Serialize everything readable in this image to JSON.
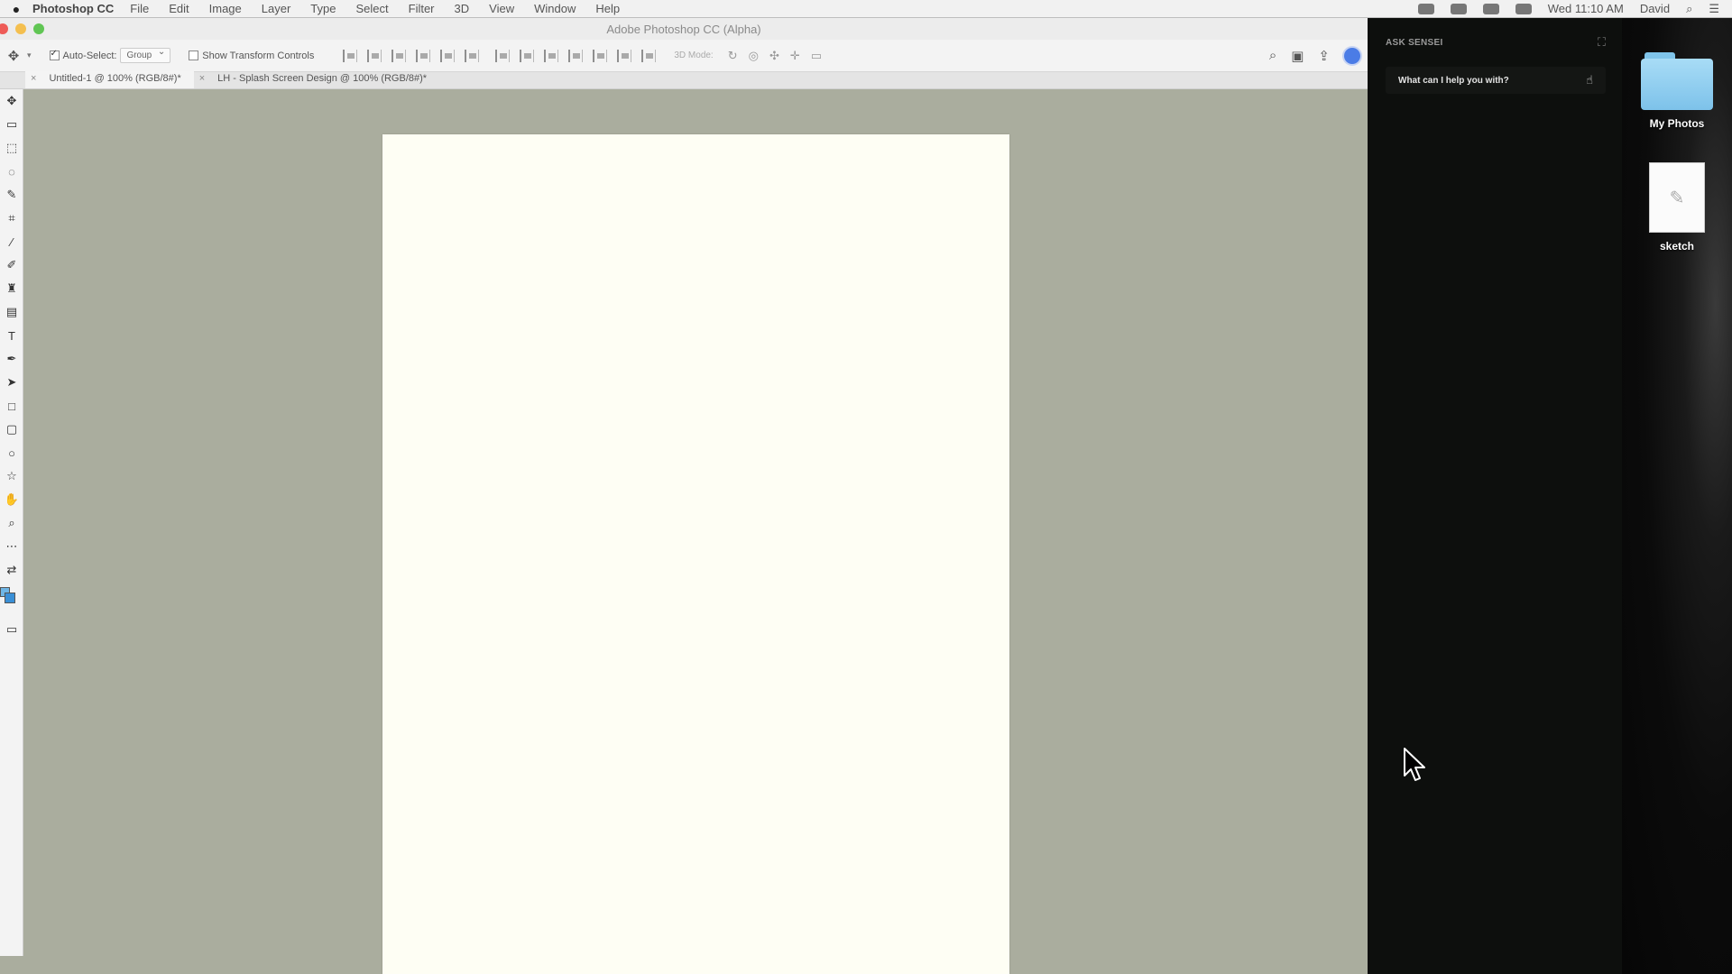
{
  "menubar": {
    "app_name": "Photoshop CC",
    "menus": [
      "File",
      "Edit",
      "Image",
      "Layer",
      "Type",
      "Select",
      "Filter",
      "3D",
      "View",
      "Window",
      "Help"
    ],
    "clock": "Wed 11:10 AM",
    "user": "David"
  },
  "window": {
    "title": "Adobe Photoshop CC (Alpha)"
  },
  "options": {
    "auto_select_label": "Auto-Select:",
    "auto_select_value": "Group",
    "show_transform_label": "Show Transform Controls",
    "mode_3d_label": "3D Mode:"
  },
  "tabs": [
    {
      "label": "Untitled-1 @ 100% (RGB/8#)*",
      "active": true
    },
    {
      "label": "LH - Splash Screen Design @ 100% (RGB/8#)*",
      "active": false
    }
  ],
  "sensei": {
    "header": "ASK SENSEI",
    "placeholder": "What can I help you with?"
  },
  "desktop": {
    "items": [
      {
        "name": "My Photos",
        "icon": "folder-icon"
      },
      {
        "name": "sketch",
        "icon": "image-file-icon"
      }
    ]
  },
  "colors": {
    "canvas_bg": "#aaad9e",
    "document": "#fefef4",
    "sensei_panel": "#0d0f0d",
    "accent_blue": "#4b7ce6"
  }
}
